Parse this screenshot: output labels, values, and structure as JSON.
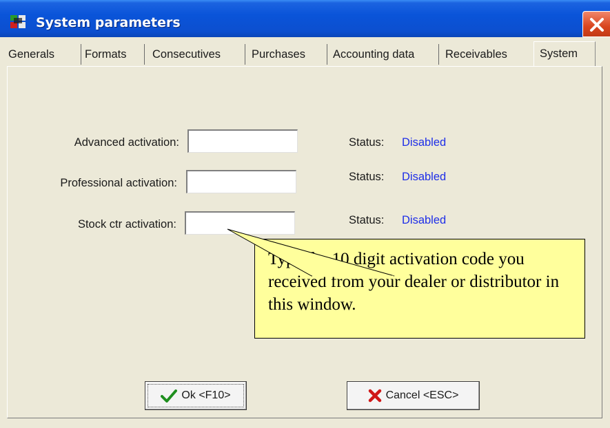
{
  "window": {
    "title": "System parameters"
  },
  "tabs": [
    {
      "label": "Generals"
    },
    {
      "label": "Formats"
    },
    {
      "label": "Consecutives"
    },
    {
      "label": "Purchases"
    },
    {
      "label": "Accounting data"
    },
    {
      "label": "Receivables"
    },
    {
      "label": "System",
      "active": true
    }
  ],
  "fields": [
    {
      "label": "Advanced activation:",
      "value": "",
      "status_label": "Status:",
      "status": "Disabled"
    },
    {
      "label": "Professional activation:",
      "value": "",
      "status_label": "Status:",
      "status": "Disabled"
    },
    {
      "label": "Stock ctr activation:",
      "value": "",
      "status_label": "Status:",
      "status": "Disabled"
    }
  ],
  "callout": {
    "text": "Type the 10 digit activation code you received from your dealer or distributor in this window."
  },
  "buttons": {
    "ok": {
      "label": "Ok <F10>",
      "icon": "checkmark-icon"
    },
    "cancel": {
      "label": "Cancel <ESC>",
      "icon": "x-icon"
    }
  },
  "colors": {
    "titlebar": "#0a54d9",
    "status_value": "#1e2ee8",
    "callout_bg": "#ffff9c",
    "window_bg": "#ece9d8"
  }
}
